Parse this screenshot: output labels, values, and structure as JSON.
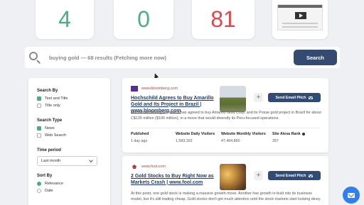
{
  "stats": [
    {
      "value": "4",
      "color": "#4bb07b"
    },
    {
      "value": "0",
      "color": "#4bb07b"
    },
    {
      "value": "81",
      "color": "#e0474c"
    }
  ],
  "search": {
    "query_text": "buying gold — 68 results (Fetching more now)",
    "button_label": "Search"
  },
  "sidebar": {
    "search_by": {
      "title": "Search By",
      "options": [
        {
          "label": "Text and Title",
          "checked": true
        },
        {
          "label": "Title only",
          "checked": false
        }
      ]
    },
    "search_type": {
      "title": "Search Type",
      "options": [
        {
          "label": "News",
          "checked": true
        },
        {
          "label": "Web Search",
          "checked": false
        }
      ]
    },
    "time_period": {
      "title": "Time period",
      "selected": "Last month"
    },
    "sort_by": {
      "title": "Sort By",
      "options": [
        {
          "label": "Relevance",
          "checked": true
        },
        {
          "label": "Date",
          "checked": false
        }
      ]
    }
  },
  "results": [
    {
      "source": "www.bloomberg.com",
      "title": "Hochschild Agrees to Buy Amarillo Gold and Its Project in Brazil | www.bloomberg.com",
      "snippet": "Hochschild Mining Plc said it has agreed to buy Amarillo Gold Corp. and its Posse gold project in Brazil for about C$135 million ($106 million), in a move that would diversify its Peru-focused operations.",
      "add_label": "+",
      "email_label": "Send Email Pitch",
      "stats": [
        {
          "label": "Published",
          "value": "1 day ago"
        },
        {
          "label": "Website Daily Visitors",
          "value": "1,583,162"
        },
        {
          "label": "Website Monthly Visitors",
          "value": "47,494,860"
        },
        {
          "label": "Site Alexa Rank",
          "value": "357"
        }
      ]
    },
    {
      "source": "www.fool.com",
      "title": "2 Gold Stocks to Buy Right Now as Markets Crash | www.fool.com",
      "snippet": "At this point, one gold stock is making a massive growth move. Another has growth in-built into its business model, but it's still trading cheap. Gold stocks don't get much attention until the stock markets start looking dicey.",
      "add_label": "+",
      "email_label": "Send Email Pitch"
    }
  ]
}
